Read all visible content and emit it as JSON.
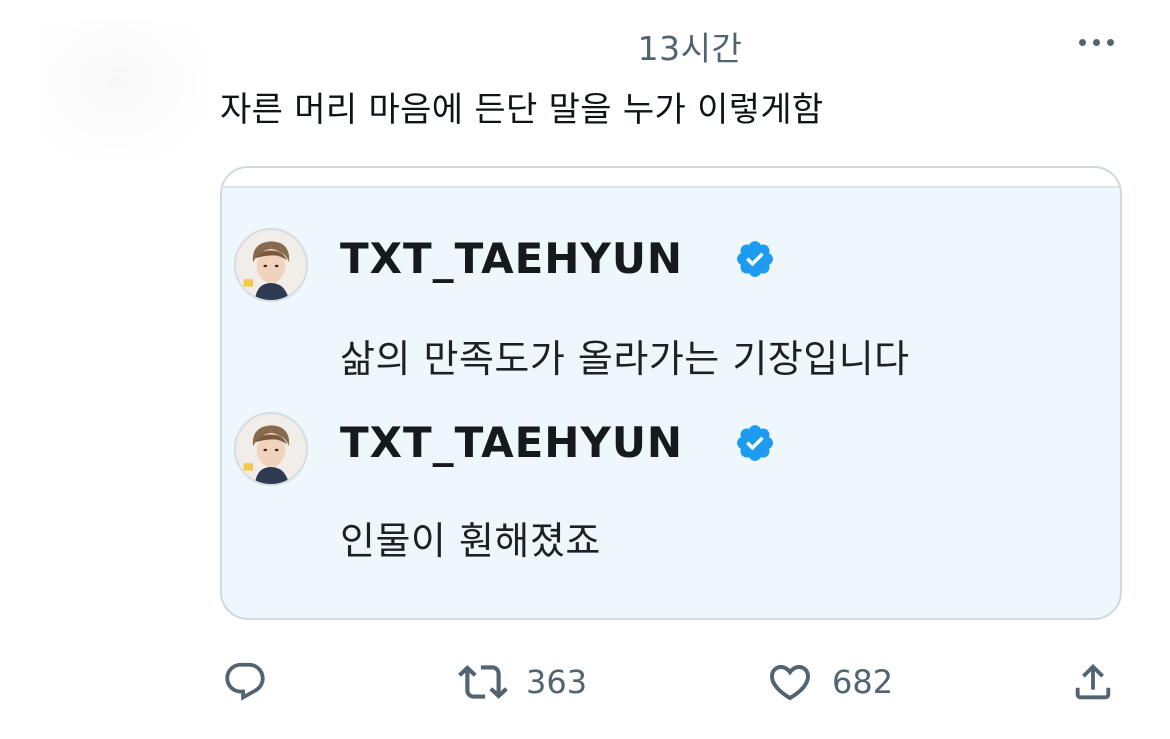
{
  "tweet": {
    "timestamp": "13시간",
    "text": "자른 머리 마음에 든단 말을 누가 이렇게함"
  },
  "media": {
    "posts": [
      {
        "username": "TXT_TAEHYUN",
        "verified": true,
        "text": "삶의 만족도가 올라가는 기장입니다"
      },
      {
        "username": "TXT_TAEHYUN",
        "verified": true,
        "text": "인물이 훤해졌죠"
      }
    ]
  },
  "actions": {
    "reply": {
      "icon": "reply-icon",
      "count": ""
    },
    "retweet": {
      "icon": "retweet-icon",
      "count": "363"
    },
    "like": {
      "icon": "heart-icon",
      "count": "682"
    },
    "share": {
      "icon": "share-icon",
      "count": ""
    }
  },
  "colors": {
    "text": "#0f1419",
    "secondary": "#536471",
    "verified": "#1d9bf0",
    "card_background": "#eef7fc",
    "card_border": "#cfd9de"
  }
}
